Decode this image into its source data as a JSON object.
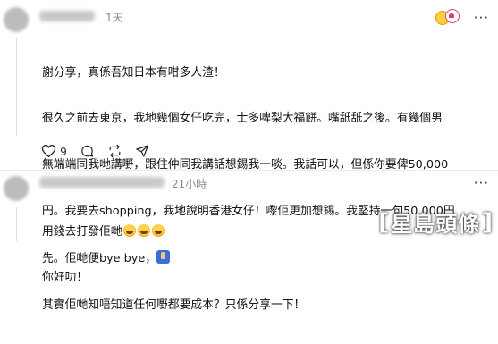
{
  "comment1": {
    "timestamp": "1天",
    "lines": [
      "謝分享，真係吾知日本有咁多人渣！",
      "很久之前去東京，我地幾個女仔吃完，士多啤梨大福餅。嘴舐舐之後。有幾個男",
      "無端端同我哋講嘢，跟住仲同我講話想錫我一啖。我話可以，但係你要俾50,000",
      "円。我要去shopping，我地說明香港女仔！嚟佢更加想錫。我堅持一句50,000円",
      "先。佢哋便bye bye，",
      "其實佢哋知唔知道任何嘢都要成本？只係分享一下！"
    ],
    "like_count": "9"
  },
  "comment2": {
    "timestamp": "21小時",
    "line1": "用錢去打發佢哋",
    "line2": "你好叻！"
  },
  "watermark": {
    "left": "[",
    "text": "星島頭條",
    "right": "]"
  },
  "icons": [
    "heart-icon",
    "comment-icon",
    "repost-icon",
    "share-icon",
    "more-icon",
    "smiley-emoji",
    "raised-hand-emoji"
  ]
}
